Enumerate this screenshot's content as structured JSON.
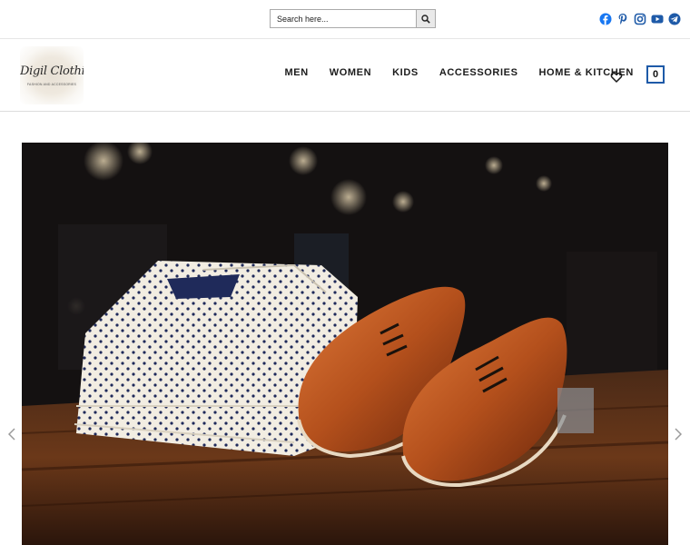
{
  "search": {
    "placeholder": "Search here...",
    "value": ""
  },
  "social": [
    {
      "name": "facebook-icon",
      "color": "#1877f2"
    },
    {
      "name": "pinterest-icon",
      "color": "#1e5aa8"
    },
    {
      "name": "instagram-icon",
      "color": "#1e5aa8"
    },
    {
      "name": "youtube-icon",
      "color": "#1e5aa8"
    },
    {
      "name": "telegram-icon",
      "color": "#1e5aa8"
    }
  ],
  "logo": {
    "text": "Digil Clothing",
    "tagline": "FASHION AND ACCESSORIES"
  },
  "nav": {
    "items": [
      "MEN",
      "WOMEN",
      "KIDS",
      "ACCESSORIES",
      "HOME & KITCHEN"
    ]
  },
  "cart": {
    "count": "0"
  },
  "colors": {
    "accent": "#1e5aa8"
  },
  "hero": {
    "image": "folded polka-dot shirts and brown leather oxford shoes on wooden table"
  },
  "slider": {
    "prev_icon": "chevron-left-icon",
    "next_icon": "chevron-right-icon"
  }
}
